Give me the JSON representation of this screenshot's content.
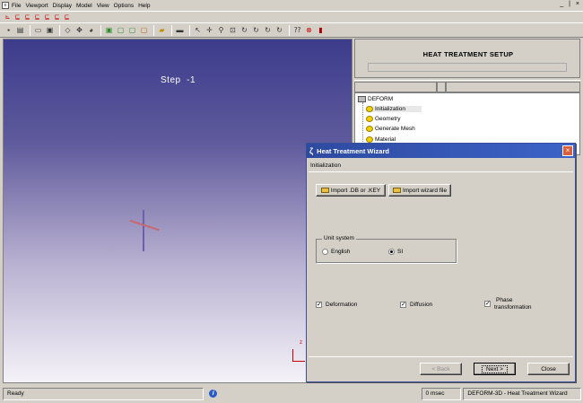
{
  "menubar": {
    "items": [
      "File",
      "Viewport",
      "Display",
      "Model",
      "View",
      "Options",
      "Help"
    ],
    "window_controls": "_ | ×"
  },
  "viewport": {
    "step_label": "Step",
    "step_value": "-1",
    "triad_z": "z"
  },
  "right_panel": {
    "title": "HEAT TREATMENT SETUP",
    "tree": {
      "root": "DEFORM",
      "items": [
        "Initialization",
        "Geometry",
        "Generate Mesh",
        "Material"
      ]
    }
  },
  "statusbar": {
    "ready": "Ready",
    "time": "0 msec",
    "module": "DEFORM-3D - Heat Treatment Wizard"
  },
  "wizard": {
    "title": "Heat Treatment Wizard",
    "section": "Initialization",
    "import_db_label": "Import .DB or .KEY",
    "import_wizard_label": "Import wizard file",
    "unit_system": {
      "label": "Unit system",
      "options": [
        "English",
        "SI"
      ],
      "selected": "SI"
    },
    "checks": {
      "deformation": "Deformation",
      "diffusion": "Diffusion",
      "phase_line1": "Phase",
      "phase_line2": "transformation"
    },
    "buttons": {
      "back": "< Back",
      "next": "Next >",
      "close": "Close"
    }
  }
}
